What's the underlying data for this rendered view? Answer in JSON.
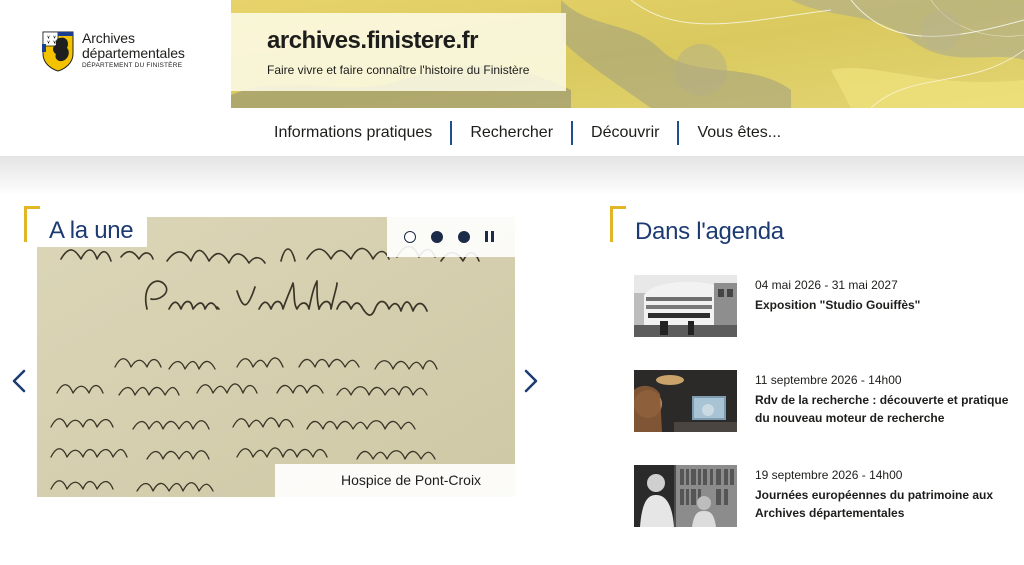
{
  "logo": {
    "line1": "Archives",
    "line2": "départementales",
    "line3": "DÉPARTEMENT DU FINISTÈRE",
    "icon": "finistere-coat-of-arms"
  },
  "site": {
    "title": "archives.finistere.fr",
    "subtitle": "Faire vivre et faire connaître l'histoire du Finistère"
  },
  "nav": {
    "items": [
      "Informations pratiques",
      "Rechercher",
      "Découvrir",
      "Vous êtes..."
    ]
  },
  "une": {
    "label": "A la une",
    "slide_caption": "Hospice de Pont-Croix",
    "slide_count": 3,
    "active_slide": 0,
    "pause_icon": "pause-icon",
    "prev_icon": "chevron-left-icon",
    "next_icon": "chevron-right-icon"
  },
  "agenda": {
    "title": "Dans l'agenda",
    "items": [
      {
        "date": "04 mai 2026 - 31 mai 2027",
        "title": "Exposition \"Studio Gouiffès\""
      },
      {
        "date": "11 septembre 2026 - 14h00",
        "title": "Rdv de la recherche : découverte et pratique du nouveau moteur de recherche"
      },
      {
        "date": "19 septembre 2026 - 14h00",
        "title": "Journées européennes du patrimoine aux Archives départementales"
      }
    ]
  },
  "colors": {
    "accent_yellow": "#e2b525",
    "title_blue": "#1d3b73",
    "nav_separator": "#1d4f91",
    "text": "#1d1d1b"
  }
}
